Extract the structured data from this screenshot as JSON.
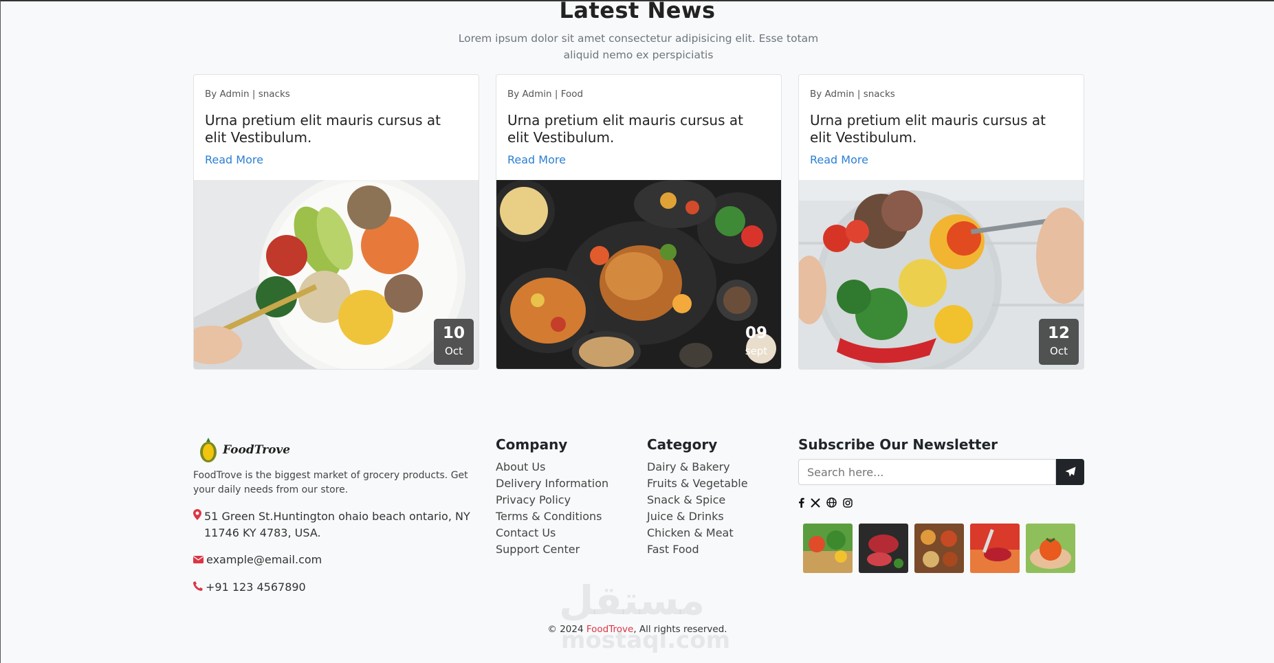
{
  "news": {
    "title": "Latest News",
    "subtitle": "Lorem ipsum dolor sit amet consectetur adipisicing elit. Esse totam aliquid nemo ex perspiciatis",
    "cards": [
      {
        "meta": "By Admin | snacks",
        "title": "Urna pretium elit mauris cursus at elit Vestibulum.",
        "link": "Read More",
        "day": "10",
        "month": "Oct"
      },
      {
        "meta": "By Admin | Food",
        "title": "Urna pretium elit mauris cursus at elit Vestibulum.",
        "link": "Read More",
        "day": "09",
        "month": "sept"
      },
      {
        "meta": "By Admin | snacks",
        "title": "Urna pretium elit mauris cursus at elit Vestibulum.",
        "link": "Read More",
        "day": "12",
        "month": "Oct"
      }
    ]
  },
  "footer": {
    "brand": "FoodTrove",
    "about": "FoodTrove is the biggest market of grocery products. Get your daily needs from our store.",
    "address": "51 Green St.Huntington ohaio beach ontario, NY 11746 KY 4783, USA.",
    "email": "example@email.com",
    "phone": "+91 123 4567890",
    "company": {
      "title": "Company",
      "links": [
        "About Us",
        "Delivery Information",
        "Privacy Policy",
        "Terms & Conditions",
        "Contact Us",
        "Support Center"
      ]
    },
    "category": {
      "title": "Category",
      "links": [
        "Dairy & Bakery",
        "Fruits & Vegetable",
        "Snack & Spice",
        "Juice & Drinks",
        "Chicken & Meat",
        "Fast Food"
      ]
    },
    "newsletter": {
      "title": "Subscribe Our Newsletter",
      "placeholder": "Search here..."
    },
    "social_icons": [
      "facebook-icon",
      "x-icon",
      "globe-icon",
      "instagram-icon"
    ],
    "copyright_prefix": "© 2024 ",
    "copyright_brand": "FoodTrove",
    "copyright_suffix": ", All rights reserved."
  },
  "watermark": {
    "arabic": "مستقل",
    "latin": "mostaql.com"
  },
  "colors": {
    "accent_red": "#dc3545",
    "link_blue": "#2a7fd4",
    "dark": "#212529"
  }
}
